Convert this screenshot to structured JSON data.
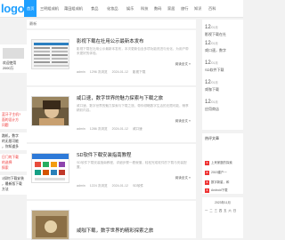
{
  "site": {
    "logo_text": "logo"
  },
  "nav": [
    {
      "label": "首页",
      "active": true
    },
    {
      "label": "三明组成机"
    },
    {
      "label": "莆田组成机"
    },
    {
      "label": "食品"
    },
    {
      "label": "化妆品"
    },
    {
      "label": "娱乐"
    },
    {
      "label": "科技"
    },
    {
      "label": "数码"
    },
    {
      "label": "家居"
    },
    {
      "label": "旅行"
    },
    {
      "label": "知识"
    },
    {
      "label": "百科"
    }
  ],
  "left": {
    "lines_a": [
      "欢迎使用",
      "2000万"
    ],
    "lines_b": [
      "蓝牙子主机?",
      "面的设计方",
      "问题"
    ],
    "lines_c": [
      "路机，数字",
      "的无限可能",
      "，你知道多"
    ],
    "lines_d": [
      "日门的下载",
      "的选择",
      "探索"
    ],
    "lines_e": [
      "1如何下载安装",
      "，最新版下载",
      "方法"
    ]
  },
  "main": {
    "heading": "最新",
    "posts": [
      {
        "title": "影视下载在社用公示最新本发布",
        "summary": "影视下载在社用公示最新本发布，本次更新包含多项功能改进与优化，为用户带来更好的体验。",
        "read_more": "阅读全文 »",
        "meta": [
          "admin",
          "1296 次浏览",
          "2024-01-12",
          "影视下载"
        ]
      },
      {
        "title": "咸口速，数字世界的魅力探索与下载之旅",
        "summary": "咸口速，数字世界的魅力探索与下载之旅，带你领略数字生活的无限可能，畅享精彩内容。",
        "read_more": "阅读全文 »",
        "meta": [
          "admin",
          "1286 次浏览",
          "2024-01-12",
          "咸口速"
        ]
      },
      {
        "title": "SD软件下载安装指南教程",
        "summary": "SD软件下载安装指南教程，详细步骤一看就懂，轻松完成软件的下载与安装配置。",
        "read_more": "阅读全文 »",
        "meta": [
          "admin",
          "1224 次浏览",
          "2024-01-12",
          "SD软件"
        ]
      },
      {
        "title": "咸咖下载，数字世界的精彩探索之旅",
        "summary": "",
        "read_more": "",
        "meta": []
      }
    ]
  },
  "side": {
    "dated": [
      {
        "day": "12",
        "month": "/01月",
        "text": "影视下载在社"
      },
      {
        "day": "12",
        "month": "/01月",
        "text": "咸口速，数字"
      },
      {
        "day": "12",
        "month": "/01月",
        "text": "SD软件下载"
      },
      {
        "day": "12",
        "month": "/01月",
        "text": "咸咖下载"
      },
      {
        "day": "12",
        "month": "/01月",
        "text": "应用商店"
      }
    ],
    "hot_title": "热评文章",
    "hot": [
      "上来家庭的探索",
      "2019建户一",
      "数字新星，和",
      "Android下载"
    ],
    "calendar_title": "2023年11月",
    "calendar_head": [
      "一",
      "二",
      "三",
      "四",
      "五",
      "六",
      "日"
    ]
  }
}
